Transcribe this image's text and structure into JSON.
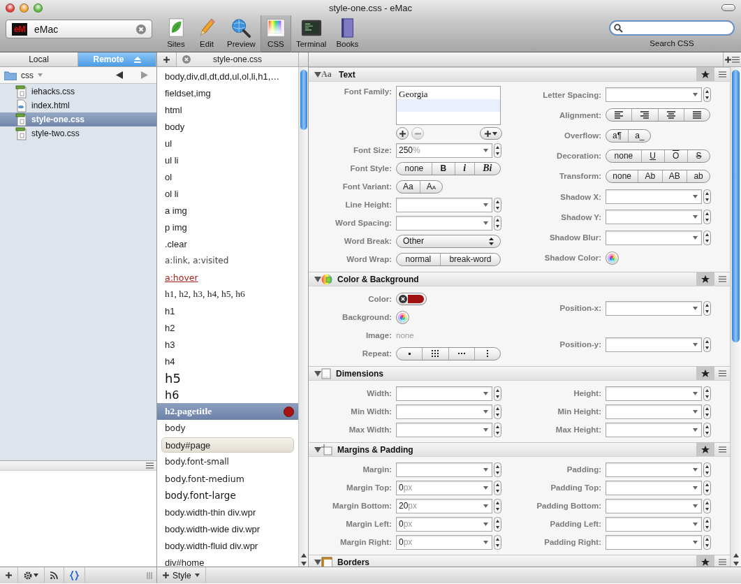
{
  "window": {
    "title": "style-one.css - eMac"
  },
  "site": {
    "logo": "eM",
    "name": "eMac"
  },
  "toolbar": [
    {
      "label": "Sites",
      "kind": "sites",
      "selected": false
    },
    {
      "label": "Edit",
      "kind": "edit",
      "selected": false
    },
    {
      "label": "Preview",
      "kind": "preview",
      "selected": false
    },
    {
      "label": "CSS",
      "kind": "css",
      "selected": true
    },
    {
      "label": "Terminal",
      "kind": "terminal",
      "selected": false
    },
    {
      "label": "Books",
      "kind": "books",
      "selected": false
    }
  ],
  "search": {
    "label": "Search CSS"
  },
  "sidebar": {
    "tabs": [
      {
        "label": "Local",
        "selected": false
      },
      {
        "label": "Remote",
        "selected": true
      }
    ],
    "folder": "css",
    "files": [
      {
        "name": "iehacks.css",
        "kind": "css",
        "selected": false
      },
      {
        "name": "index.html",
        "kind": "html",
        "selected": false
      },
      {
        "name": "style-one.css",
        "kind": "css",
        "selected": true
      },
      {
        "name": "style-two.css",
        "kind": "css",
        "selected": false
      }
    ]
  },
  "document_tab": {
    "label": "style-one.css"
  },
  "selectors": [
    {
      "text": "body,div,dl,dt,dd,ul,ol,li,h1,…",
      "kind": "sans",
      "selected": false,
      "highlighted": false,
      "marked": false
    },
    {
      "text": "fieldset,img",
      "kind": "sans",
      "selected": false,
      "highlighted": false,
      "marked": false
    },
    {
      "text": "html",
      "kind": "sans",
      "selected": false,
      "highlighted": false,
      "marked": false
    },
    {
      "text": "body",
      "kind": "sans",
      "selected": false,
      "highlighted": false,
      "marked": false
    },
    {
      "text": "ul",
      "kind": "sans",
      "selected": false,
      "highlighted": false,
      "marked": false
    },
    {
      "text": "ul li",
      "kind": "sans",
      "selected": false,
      "highlighted": false,
      "marked": false
    },
    {
      "text": "ol",
      "kind": "sans",
      "selected": false,
      "highlighted": false,
      "marked": false
    },
    {
      "text": "ol li",
      "kind": "sans",
      "selected": false,
      "highlighted": false,
      "marked": false
    },
    {
      "text": "a img",
      "kind": "sans",
      "selected": false,
      "highlighted": false,
      "marked": false
    },
    {
      "text": "p img",
      "kind": "sans",
      "selected": false,
      "highlighted": false,
      "marked": false
    },
    {
      "text": ".clear",
      "kind": "sans",
      "selected": false,
      "highlighted": false,
      "marked": false
    },
    {
      "text": "a:link, a:visited",
      "kind": "muted",
      "selected": false,
      "highlighted": false,
      "marked": false
    },
    {
      "text": "a:hover",
      "kind": "link",
      "selected": false,
      "highlighted": false,
      "marked": false
    },
    {
      "text": "h1, h2, h3, h4, h5, h6",
      "kind": "serif",
      "selected": false,
      "highlighted": false,
      "marked": false
    },
    {
      "text": "h1",
      "kind": "sans",
      "selected": false,
      "highlighted": false,
      "marked": false
    },
    {
      "text": "h2",
      "kind": "sans",
      "selected": false,
      "highlighted": false,
      "marked": false
    },
    {
      "text": "h3",
      "kind": "sans",
      "selected": false,
      "highlighted": false,
      "marked": false
    },
    {
      "text": "h4",
      "kind": "sans",
      "selected": false,
      "highlighted": false,
      "marked": false
    },
    {
      "text": "h5",
      "kind": "h5",
      "selected": false,
      "highlighted": false,
      "marked": false
    },
    {
      "text": "h6",
      "kind": "h6",
      "selected": false,
      "highlighted": false,
      "marked": false
    },
    {
      "text": "h2.pagetitle",
      "kind": "serif",
      "selected": true,
      "highlighted": false,
      "marked": true
    },
    {
      "text": "body",
      "kind": "small",
      "selected": false,
      "highlighted": false,
      "marked": false
    },
    {
      "text": "body#page",
      "kind": "sans",
      "selected": false,
      "highlighted": true,
      "marked": false
    },
    {
      "text": "body.font-small",
      "kind": "small",
      "selected": false,
      "highlighted": false,
      "marked": false
    },
    {
      "text": "body.font-medium",
      "kind": "medium",
      "selected": false,
      "highlighted": false,
      "marked": false
    },
    {
      "text": "body.font-large",
      "kind": "large",
      "selected": false,
      "highlighted": false,
      "marked": false
    },
    {
      "text": "body.width-thin div.wpr",
      "kind": "sans",
      "selected": false,
      "highlighted": false,
      "marked": false
    },
    {
      "text": "body.width-wide div.wpr",
      "kind": "sans",
      "selected": false,
      "highlighted": false,
      "marked": false
    },
    {
      "text": "body.width-fluid div.wpr",
      "kind": "sans",
      "selected": false,
      "highlighted": false,
      "marked": false
    },
    {
      "text": "div#home",
      "kind": "sans",
      "selected": false,
      "highlighted": false,
      "marked": false
    }
  ],
  "inspector": {
    "sections": [
      {
        "title": "Text",
        "icon": {
          "kind": "letters",
          "text": "Aa"
        },
        "expanded": true,
        "columns": [
          [
            {
              "label": "Font Family:",
              "kind": "fontlist",
              "items": [
                "Georgia"
              ]
            },
            {
              "label": "Font Size:",
              "kind": "combo",
              "value": "250",
              "unit": "%"
            },
            {
              "label": "Font Style:",
              "kind": "segmented",
              "options": [
                {
                  "text": "none",
                  "kind": "plain"
                },
                {
                  "text": "B",
                  "kind": "bold"
                },
                {
                  "text": "i",
                  "kind": "italic"
                },
                {
                  "text": "Bi",
                  "kind": "bold-italic"
                }
              ]
            },
            {
              "label": "Font Variant:",
              "kind": "segmented",
              "options": [
                {
                  "text": "Aa",
                  "kind": "plain"
                },
                {
                  "text": "Aa",
                  "kind": "small-caps"
                }
              ]
            },
            {
              "label": "Line Height:",
              "kind": "combo"
            },
            {
              "label": "Word Spacing:",
              "kind": "combo"
            },
            {
              "label": "Word Break:",
              "kind": "popup",
              "value": "Other"
            },
            {
              "label": "Word Wrap:",
              "kind": "segmented",
              "options": [
                {
                  "text": "normal",
                  "kind": "plain"
                },
                {
                  "text": "break-word",
                  "kind": "plain"
                }
              ]
            }
          ],
          [
            {
              "label": "Letter Spacing:",
              "kind": "combo"
            },
            {
              "label": "Alignment:",
              "kind": "alignment"
            },
            {
              "label": "Overflow:",
              "kind": "segmented",
              "options": [
                {
                  "text": "a¶",
                  "kind": "plain"
                },
                {
                  "text": "a_",
                  "kind": "plain"
                }
              ]
            },
            {
              "label": "Decoration:",
              "kind": "segmented",
              "options": [
                {
                  "text": "none",
                  "kind": "plain"
                },
                {
                  "text": "U",
                  "kind": "underline"
                },
                {
                  "text": "O",
                  "kind": "overline"
                },
                {
                  "text": "S",
                  "kind": "line-through"
                }
              ]
            },
            {
              "label": "Transform:",
              "kind": "segmented",
              "options": [
                {
                  "text": "none",
                  "kind": "plain"
                },
                {
                  "text": "Ab",
                  "kind": "plain"
                },
                {
                  "text": "AB",
                  "kind": "plain"
                },
                {
                  "text": "ab",
                  "kind": "plain"
                }
              ]
            },
            {
              "label": "Shadow X:",
              "kind": "combo"
            },
            {
              "label": "Shadow Y:",
              "kind": "combo"
            },
            {
              "label": "Shadow Blur:",
              "kind": "combo"
            },
            {
              "label": "Shadow Color:",
              "kind": "color"
            }
          ]
        ]
      },
      {
        "title": "Color & Background",
        "icon": {
          "kind": "color"
        },
        "expanded": true,
        "columns": [
          [
            {
              "label": "Color:",
              "kind": "color",
              "color": "#9e1212"
            },
            {
              "label": "Background:",
              "kind": "color"
            },
            {
              "label": "Image:",
              "kind": "text",
              "value": "none"
            },
            {
              "label": "Repeat:",
              "kind": "repeat"
            }
          ],
          [
            {
              "label": "Position-x:",
              "kind": "combo"
            },
            {
              "label": "Position-y:",
              "kind": "combo"
            }
          ]
        ]
      },
      {
        "title": "Dimensions",
        "icon": {
          "kind": "page"
        },
        "expanded": true,
        "columns": [
          [
            {
              "label": "Width:",
              "kind": "combo"
            },
            {
              "label": "Min Width:",
              "kind": "combo"
            },
            {
              "label": "Max Width:",
              "kind": "combo"
            }
          ],
          [
            {
              "label": "Height:",
              "kind": "combo"
            },
            {
              "label": "Min Height:",
              "kind": "combo"
            },
            {
              "label": "Max Height:",
              "kind": "combo"
            }
          ]
        ]
      },
      {
        "title": "Margins & Padding",
        "icon": {
          "kind": "margins"
        },
        "expanded": true,
        "columns": [
          [
            {
              "label": "Margin:",
              "kind": "combo"
            },
            {
              "label": "Margin Top:",
              "kind": "combo",
              "value": "0",
              "unit": "px"
            },
            {
              "label": "Margin Bottom:",
              "kind": "combo",
              "value": "20",
              "unit": "px"
            },
            {
              "label": "Margin Left:",
              "kind": "combo",
              "value": "0",
              "unit": "px"
            },
            {
              "label": "Margin Right:",
              "kind": "combo",
              "value": "0",
              "unit": "px"
            }
          ],
          [
            {
              "label": "Padding:",
              "kind": "combo"
            },
            {
              "label": "Padding Top:",
              "kind": "combo"
            },
            {
              "label": "Padding Bottom:",
              "kind": "combo"
            },
            {
              "label": "Padding Left:",
              "kind": "combo"
            },
            {
              "label": "Padding Right:",
              "kind": "combo"
            }
          ]
        ]
      },
      {
        "title": "Borders",
        "icon": {
          "kind": "borders"
        },
        "expanded": true
      }
    ]
  },
  "status_bar": {
    "style_button": "Style"
  }
}
